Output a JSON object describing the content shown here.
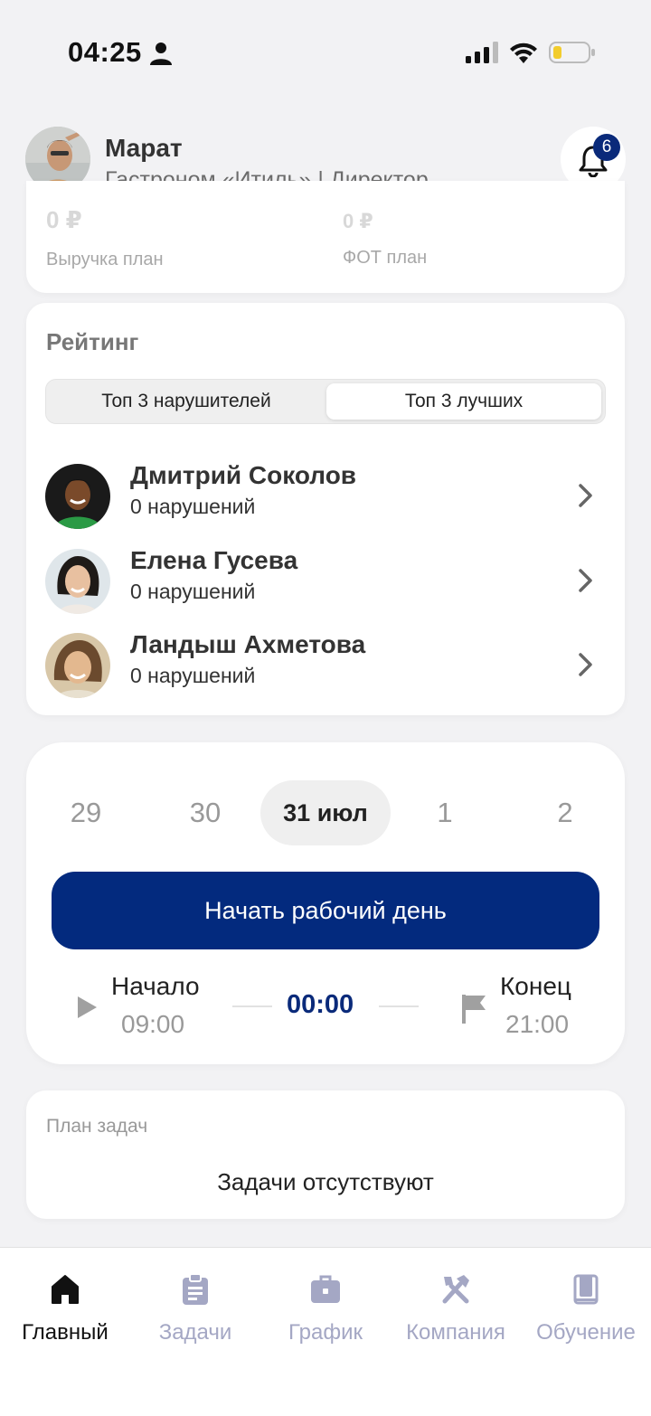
{
  "status_bar": {
    "time": "04:25"
  },
  "header": {
    "name": "Марат",
    "subtitle": "Гастроном «Итиль» | Директор",
    "notifications_count": "6"
  },
  "stats": {
    "revenue_value": "0 ₽",
    "revenue_label": "Выручка план",
    "payroll_value": "0 ₽",
    "payroll_label": "ФОТ план"
  },
  "rating": {
    "title": "Рейтинг",
    "tabs": [
      "Топ 3 нарушителей",
      "Топ 3 лучших"
    ],
    "selected_tab": "Топ 3 лучших",
    "people": [
      {
        "name": "Дмитрий Соколов",
        "violations": "0 нарушений"
      },
      {
        "name": "Елена Гусева",
        "violations": "0 нарушений"
      },
      {
        "name": "Ландыш Ахметова",
        "violations": "0 нарушений"
      }
    ]
  },
  "workday": {
    "dates": [
      "29",
      "30",
      "31 июл",
      "1",
      "2"
    ],
    "selected_date": "31 июл",
    "start_button": "Начать рабочий день",
    "start_label": "Начало",
    "start_time": "09:00",
    "timer": "00:00",
    "end_label": "Конец",
    "end_time": "21:00"
  },
  "tasks": {
    "title": "План задач",
    "empty": "Задачи отсутствуют"
  },
  "tabbar": {
    "items": [
      {
        "label": "Главный",
        "icon": "home-icon"
      },
      {
        "label": "Задачи",
        "icon": "clipboard-icon"
      },
      {
        "label": "График",
        "icon": "briefcase-icon"
      },
      {
        "label": "Компания",
        "icon": "tools-icon"
      },
      {
        "label": "Обучение",
        "icon": "book-icon"
      }
    ],
    "active": "Главный"
  },
  "colors": {
    "primary": "#032a7e",
    "tab_inactive": "#a4a7c4",
    "background": "#f2f2f4"
  }
}
